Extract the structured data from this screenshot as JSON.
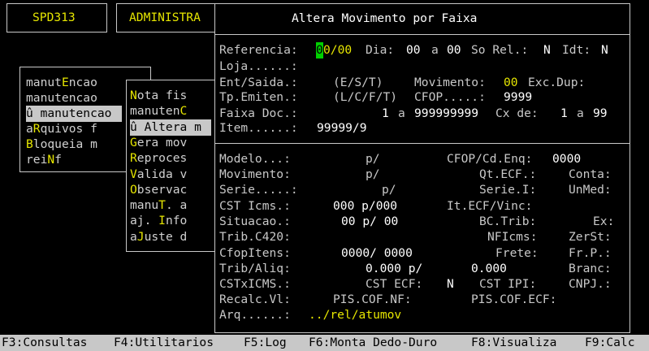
{
  "top_bar": {
    "system_id": "SPD313",
    "module": "ADMINISTRA"
  },
  "left_menu": [
    {
      "pre": "manut",
      "key": "E",
      "post": "ncao"
    },
    {
      "pre": "manutencao",
      "key": "",
      "post": ""
    },
    {
      "pre": "û manutencao",
      "key": "",
      "post": "",
      "selected": true
    },
    {
      "pre": "a",
      "key": "R",
      "post": "quivos f"
    },
    {
      "pre": "",
      "key": "B",
      "post": "loqueia m"
    },
    {
      "pre": "rei",
      "key": "N",
      "post": "f"
    }
  ],
  "sub_menu": [
    {
      "pre": "",
      "key": "N",
      "post": "ota fis"
    },
    {
      "pre": "manuten",
      "key": "C",
      "post": ""
    },
    {
      "pre": "û Altera m",
      "key": "",
      "post": "",
      "selected": true
    },
    {
      "pre": "",
      "key": "G",
      "post": "era mov"
    },
    {
      "pre": "",
      "key": "R",
      "post": "eproces"
    },
    {
      "pre": "",
      "key": "V",
      "post": "alida v"
    },
    {
      "pre": "",
      "key": "O",
      "post": "bservac"
    },
    {
      "pre": "manu",
      "key": "T",
      "post": ". a"
    },
    {
      "pre": "aj. ",
      "key": "I",
      "post": "nfo"
    },
    {
      "pre": "a",
      "key": "J",
      "post": "uste d"
    }
  ],
  "dialog": {
    "title": "Altera Movimento por Faixa",
    "referencia_label": "Referencia:",
    "referencia_month_cursor": "0",
    "referencia_rest": "0/00",
    "dia_label": "Dia:",
    "dia_from": "00",
    "a_label": "a",
    "dia_to": "00",
    "so_rel_label": "So Rel.:",
    "so_rel_value": "N",
    "idt_label": "Idt:",
    "idt_value": "N",
    "loja_label": "Loja......:",
    "ent_saida_label": "Ent/Saida.:",
    "ent_saida_hint": "(E/S/T)",
    "movimento_label": "Movimento:",
    "movimento_value": "00",
    "exc_dup_label": "Exc.Dup:",
    "tp_emiten_label": "Tp.Emiten.:",
    "tp_emiten_hint": "(L/C/F/T)",
    "cfop_label": "CFOP.....:",
    "cfop_value": "9999",
    "faixa_doc_label": "Faixa Doc.:",
    "faixa_doc_from": "1",
    "faixa_doc_to": "999999999",
    "cx_de_label": "Cx de:",
    "cx_from": "1",
    "cx_to": "99",
    "item_label": "Item......:",
    "item_value": "99999/9",
    "modelo_label": "Modelo...:",
    "modelo_value": "p/",
    "cfop_cd_enq_label": "CFOP/Cd.Enq:",
    "cfop_cd_enq_value": "0000",
    "movimento2_label": "Movimento:",
    "movimento2_value": "p/",
    "qt_ecf_label": "Qt.ECF.:",
    "conta_label": "Conta:",
    "serie_label": "Serie.....:",
    "serie_value": "p/",
    "serie_i_label": "Serie.I:",
    "unmed_label": "UnMed:",
    "cst_icms_label": "CST Icms.:",
    "cst_icms_value": "000 p/000",
    "it_ecf_vinc_label": "It.ECF/Vinc:",
    "situacao_label": "Situacao.:",
    "situacao_value": "00 p/ 00",
    "bc_trib_label": "BC.Trib:",
    "ex_label": "Ex:",
    "trib_c420_label": "Trib.C420:",
    "nficms_label": "NFIcms:",
    "zerst_label": "ZerSt:",
    "cfopitens_label": "CfopItens:",
    "cfopitens_value": "0000/ 0000",
    "frete_label": "Frete:",
    "fr_p_label": "Fr.P.:",
    "trib_aliq_label": "Trib/Aliq:",
    "trib_aliq_value": "0.000 p/",
    "trib_aliq_value2": "0.000",
    "branc_label": "Branc:",
    "cstxicms_label": "CSTxICMS.:",
    "cst_ecf_label": "CST ECF:",
    "cst_ecf_value": "N",
    "cst_ipi_label": "CST IPI:",
    "cnpj_label": "CNPJ.:",
    "recalc_label": "Recalc.Vl:",
    "pis_cof_nf_label": "PIS.COF.NF:",
    "pis_cof_ecf_label": "PIS.COF.ECF:",
    "arq_label": "Arq......:",
    "arq_value": "../rel/atumov"
  },
  "function_keys": [
    "F3:Consultas",
    "F4:Utilitarios",
    "F5:Log",
    "F6:Monta Dedo-Duro",
    "F8:Visualiza",
    "F9:Calc"
  ]
}
